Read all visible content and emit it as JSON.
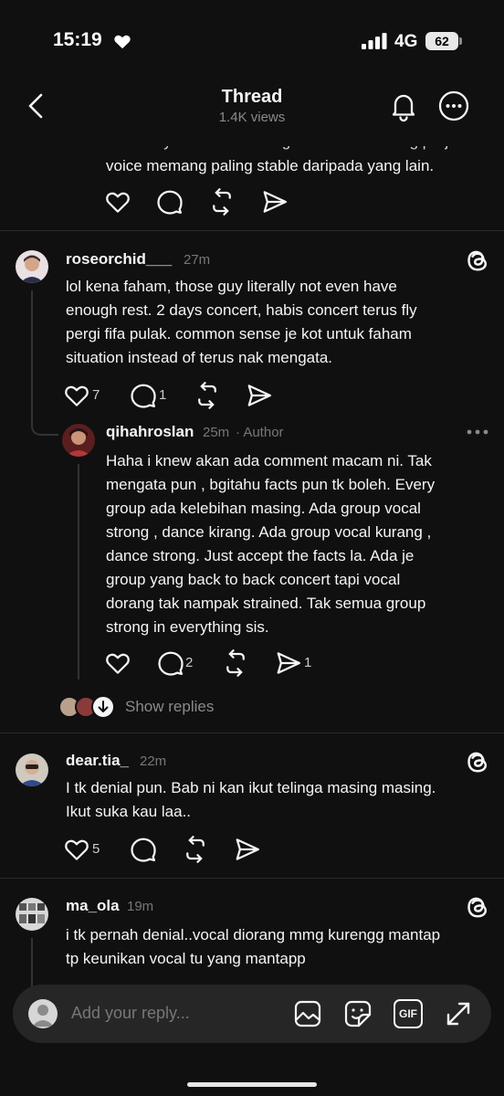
{
  "status_bar": {
    "time": "15:19",
    "network": "4G",
    "battery": "62"
  },
  "header": {
    "title": "Thread",
    "views": "1.4K views"
  },
  "posts": [
    {
      "text_lines": [
        "inifact my bias is Jin & Suga tau dulu. Feeling praji ok",
        "voice memang paling stable daripada yang lain."
      ]
    },
    {
      "username": "roseorchid___",
      "time": "27m",
      "text_lines": [
        "lol kena faham, those guy literally not even have",
        "enough rest. 2 days concert, habis concert terus fly",
        "pergi fifa pulak. common sense je kot untuk faham",
        "situation instead of terus nak mengata."
      ],
      "likes": "7",
      "replies": "1"
    },
    {
      "username": "qihahroslan",
      "time": "25m",
      "author_label": "· Author",
      "text_lines": [
        "Haha i knew akan ada comment macam ni. Tak",
        "mengata pun , bgitahu facts pun tk boleh. Every",
        "group ada kelebihan masing. Ada group vocal",
        "strong , dance kirang. Ada group vocal kurang ,",
        "dance strong. Just accept the facts la. Ada je",
        "group yang back to back concert tapi vocal",
        "dorang tak nampak strained. Tak semua group",
        "strong in everything sis."
      ],
      "replies": "2",
      "shares": "1",
      "show_replies": "Show replies"
    },
    {
      "username": "dear.tia_",
      "time": "22m",
      "text_lines": [
        "I tk denial pun. Bab ni kan ikut telinga masing masing.",
        "Ikut suka kau laa.."
      ],
      "likes": "5"
    },
    {
      "username": "ma_ola",
      "time": "19m",
      "text_lines": [
        "i tk pernah denial..vocal diorang mmg kurengg mantap",
        "tp keunikan vocal tu yang  mantapp"
      ]
    }
  ],
  "reply_bar": {
    "placeholder": "Add your reply...",
    "gif_label": "GIF"
  },
  "icons": {
    "back": "chevron-left-icon",
    "bell": "bell-icon",
    "more": "ellipsis-circle-icon",
    "like": "heart-icon",
    "reply": "comment-icon",
    "repost": "repost-icon",
    "share": "send-icon",
    "threads": "threads-logo-icon"
  },
  "colors": {
    "background": "#101010",
    "text": "#f3f5f7",
    "muted": "#777777",
    "divider": "#2a2a2a"
  }
}
